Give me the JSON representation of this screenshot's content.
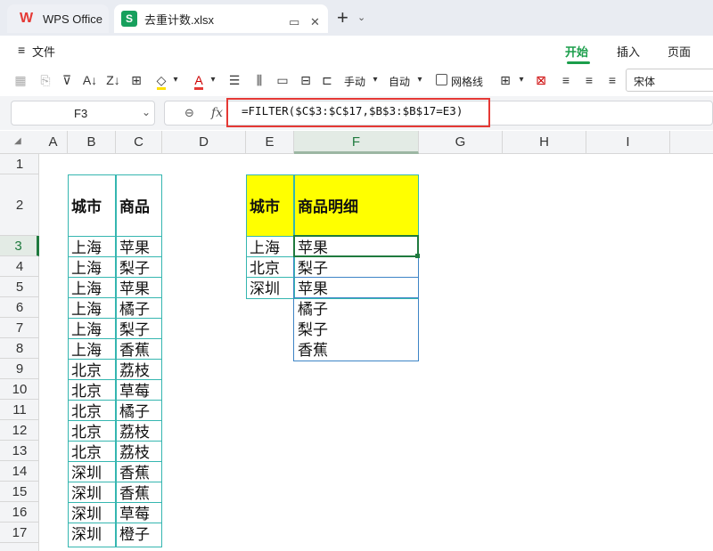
{
  "tabs": {
    "app_label": "WPS Office",
    "file_label": "去重计数.xlsx",
    "new_tab": "+"
  },
  "menu": {
    "file": "文件",
    "start": "开始",
    "insert": "插入",
    "page": "页面"
  },
  "toolbar": {
    "manual": "手动",
    "auto": "自动",
    "gridlines": "网格线",
    "font": "宋体"
  },
  "formula_bar": {
    "cell_ref": "F3",
    "fx": "fx",
    "formula": "=FILTER($C$3:$C$17,$B$3:$B$17=E3)"
  },
  "columns": [
    "A",
    "B",
    "C",
    "D",
    "E",
    "F",
    "G",
    "H",
    "I"
  ],
  "rows": [
    "1",
    "2",
    "3",
    "4",
    "5",
    "6",
    "7",
    "8",
    "9",
    "10",
    "11",
    "12",
    "13",
    "14",
    "15",
    "16",
    "17"
  ],
  "table1": {
    "header": [
      "城市",
      "商品"
    ],
    "rows": [
      [
        "上海",
        "苹果"
      ],
      [
        "上海",
        "梨子"
      ],
      [
        "上海",
        "苹果"
      ],
      [
        "上海",
        "橘子"
      ],
      [
        "上海",
        "梨子"
      ],
      [
        "上海",
        "香蕉"
      ],
      [
        "北京",
        "荔枝"
      ],
      [
        "北京",
        "草莓"
      ],
      [
        "北京",
        "橘子"
      ],
      [
        "北京",
        "荔枝"
      ],
      [
        "北京",
        "荔枝"
      ],
      [
        "深圳",
        "香蕉"
      ],
      [
        "深圳",
        "香蕉"
      ],
      [
        "深圳",
        "草莓"
      ],
      [
        "深圳",
        "橙子"
      ]
    ]
  },
  "table2": {
    "header": [
      "城市",
      "商品明细"
    ],
    "cities": [
      "上海",
      "北京",
      "深圳"
    ],
    "details": [
      "苹果",
      "梨子",
      "苹果",
      "橘子",
      "梨子",
      "香蕉"
    ]
  },
  "colors": {
    "accent": "#1b9e4b",
    "highlight": "#e53935",
    "table_border": "#35b6b0",
    "header_fill": "#ffff00"
  }
}
